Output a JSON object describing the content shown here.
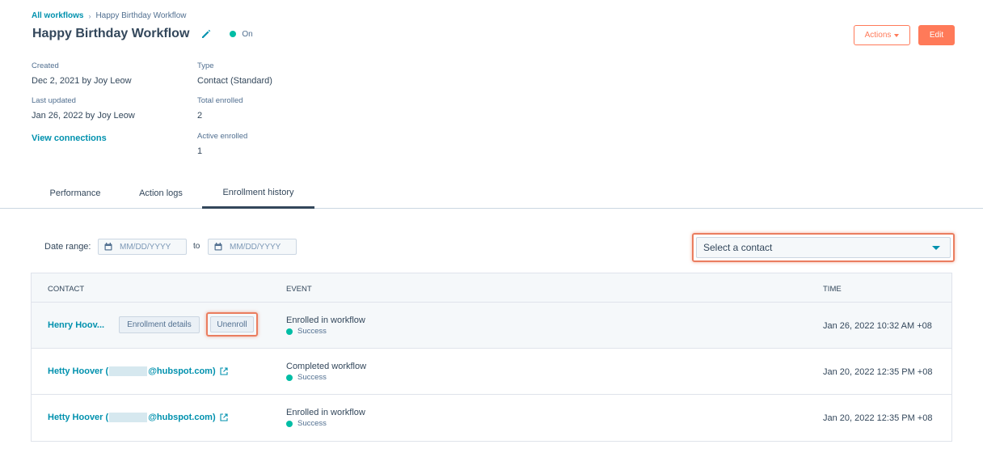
{
  "breadcrumb": {
    "parent": "All workflows",
    "separator": "›",
    "current": "Happy Birthday Workflow"
  },
  "header": {
    "title": "Happy Birthday Workflow",
    "status_label": "On",
    "status_color": "#00bda5",
    "actions_label": "Actions",
    "edit_label": "Edit"
  },
  "details": {
    "created_label": "Created",
    "created_value": "Dec 2, 2021 by Joy Leow",
    "updated_label": "Last updated",
    "updated_value": "Jan 26, 2022 by Joy Leow",
    "view_connections": "View connections",
    "type_label": "Type",
    "type_value": "Contact (Standard)",
    "total_label": "Total enrolled",
    "total_value": "2",
    "active_label": "Active enrolled",
    "active_value": "1"
  },
  "tabs": [
    {
      "label": "Performance",
      "active": false
    },
    {
      "label": "Action logs",
      "active": false
    },
    {
      "label": "Enrollment history",
      "active": true
    }
  ],
  "filters": {
    "date_range_label": "Date range:",
    "from_placeholder": "MM/DD/YYYY",
    "to_label": "to",
    "to_placeholder": "MM/DD/YYYY",
    "contact_select": "Select a contact"
  },
  "table": {
    "columns": [
      "CONTACT",
      "EVENT",
      "TIME"
    ],
    "rows": [
      {
        "contact": "Henry Hoov...",
        "enrollment_details": "Enrollment details",
        "unenroll": "Unenroll",
        "event": "Enrolled in workflow",
        "status": "Success",
        "time": "Jan 26, 2022 10:32 AM +08"
      },
      {
        "contact_prefix": "Hetty Hoover (",
        "contact_suffix": "@hubspot.com)",
        "event": "Completed workflow",
        "status": "Success",
        "time": "Jan 20, 2022 12:35 PM +08"
      },
      {
        "contact_prefix": "Hetty Hoover (",
        "contact_suffix": "@hubspot.com)",
        "event": "Enrolled in workflow",
        "status": "Success",
        "time": "Jan 20, 2022 12:35 PM +08"
      }
    ]
  },
  "colors": {
    "accent": "#ff7a59",
    "link": "#0091ae",
    "success": "#00bda5",
    "highlight": "#ea7d5f"
  }
}
